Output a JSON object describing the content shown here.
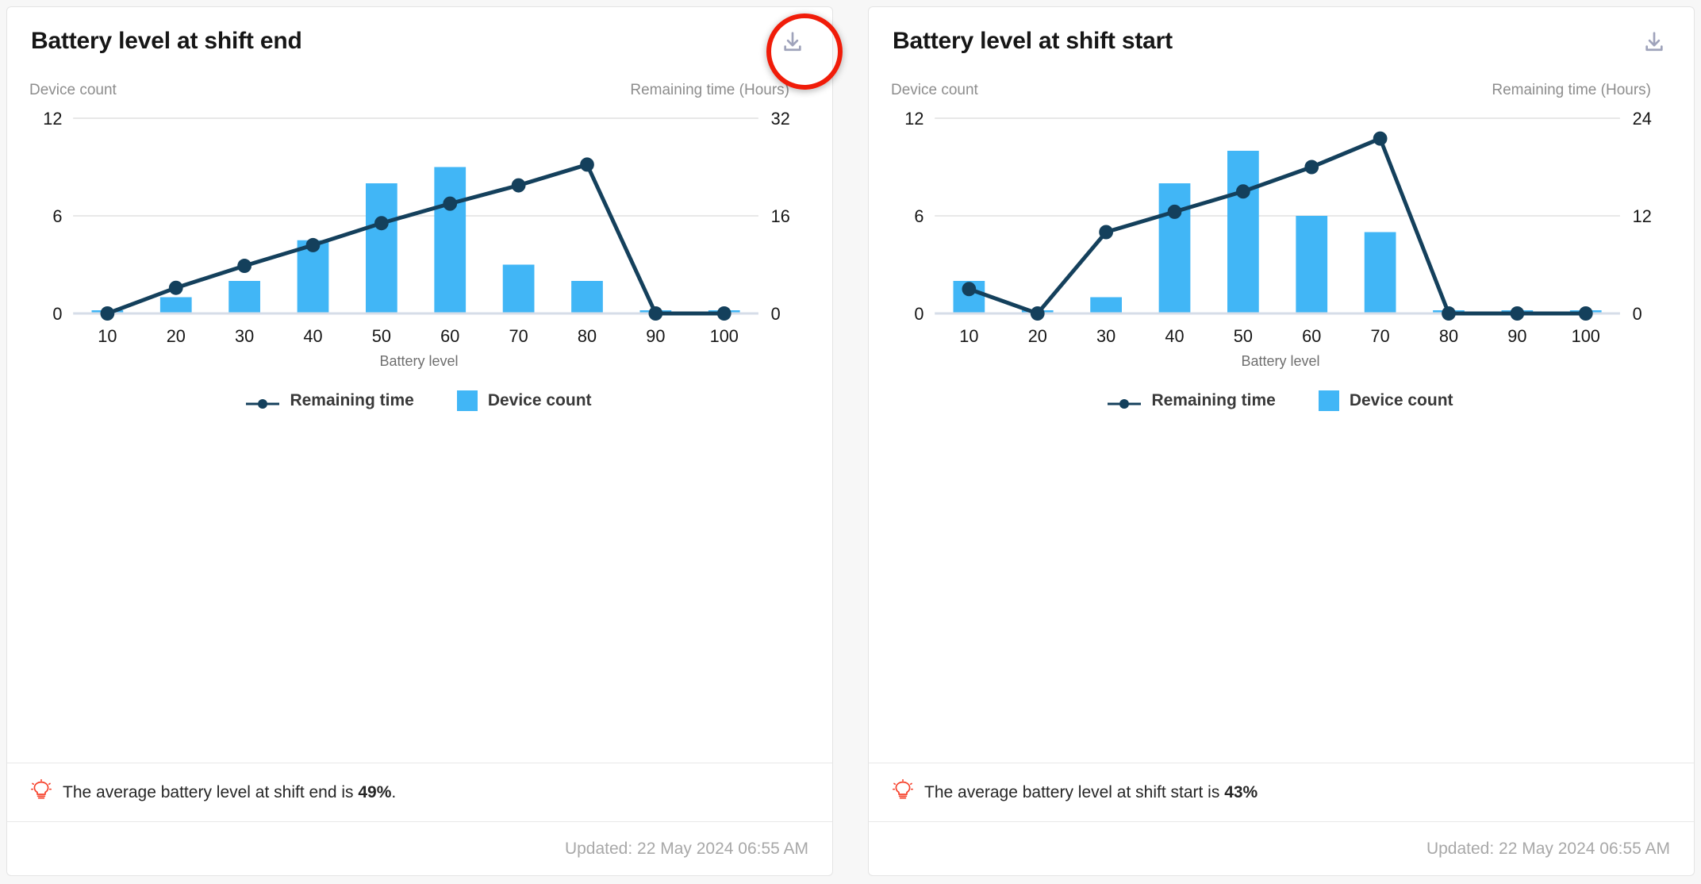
{
  "colors": {
    "bar": "#41b6f6",
    "line": "#14405c",
    "grid": "#e8e8e8",
    "baseline": "#d6dde8",
    "annotation": "#f01c09",
    "muted": "#8d8d8d",
    "title": "#161616"
  },
  "cards": [
    {
      "title": "Battery level at shift end",
      "download_icon": "download-icon",
      "left_axis_title": "Device count",
      "right_axis_title": "Remaining time (Hours)",
      "legend": [
        {
          "label": "Remaining time",
          "marker": "line-marker"
        },
        {
          "label": "Device count",
          "marker": "square-swatch"
        }
      ],
      "insight_icon": "lightbulb-icon",
      "insight_prefix": "The average battery level at shift end is ",
      "insight_value": "49%",
      "insight_suffix": ".",
      "updated": "Updated: 22 May 2024 06:55 AM",
      "chart_data": {
        "type": "bar",
        "title": "Battery level at shift end",
        "xlabel": "Battery level",
        "ylabel": "Device count",
        "y2label": "Remaining time (Hours)",
        "categories": [
          "10",
          "20",
          "30",
          "40",
          "50",
          "60",
          "70",
          "80",
          "90",
          "100"
        ],
        "ylim": [
          0,
          12
        ],
        "yticks": [
          0,
          6,
          12
        ],
        "y2lim": [
          0,
          32
        ],
        "y2ticks": [
          0,
          16,
          32
        ],
        "grid": true,
        "legend_position": "bottom-center",
        "series": [
          {
            "name": "Device count",
            "type": "bar",
            "axis": "left",
            "values": [
              0.12,
              1.0,
              2.0,
              4.5,
              8.0,
              9.0,
              3.0,
              2.0,
              0.12,
              0.12
            ]
          },
          {
            "name": "Remaining time",
            "type": "line",
            "axis": "right",
            "values": [
              0,
              4.2,
              7.8,
              11.2,
              14.8,
              18.0,
              21.0,
              24.4,
              0,
              0
            ]
          }
        ]
      }
    },
    {
      "title": "Battery level at shift start",
      "download_icon": "download-icon",
      "left_axis_title": "Device count",
      "right_axis_title": "Remaining time (Hours)",
      "legend": [
        {
          "label": "Remaining time",
          "marker": "line-marker"
        },
        {
          "label": "Device count",
          "marker": "square-swatch"
        }
      ],
      "insight_icon": "lightbulb-icon",
      "insight_prefix": "The average battery level at shift start is ",
      "insight_value": "43%",
      "insight_suffix": "",
      "updated": "Updated: 22 May 2024 06:55 AM",
      "chart_data": {
        "type": "bar",
        "title": "Battery level at shift start",
        "xlabel": "Battery level",
        "ylabel": "Device count",
        "y2label": "Remaining time (Hours)",
        "categories": [
          "10",
          "20",
          "30",
          "40",
          "50",
          "60",
          "70",
          "80",
          "90",
          "100"
        ],
        "ylim": [
          0,
          12
        ],
        "yticks": [
          0,
          6,
          12
        ],
        "y2lim": [
          0,
          24
        ],
        "y2ticks": [
          0,
          12,
          24
        ],
        "grid": true,
        "legend_position": "bottom-center",
        "series": [
          {
            "name": "Device count",
            "type": "bar",
            "axis": "left",
            "values": [
              2.0,
              0.12,
              1.0,
              8.0,
              10.0,
              6.0,
              5.0,
              0.12,
              0.12,
              0.12
            ]
          },
          {
            "name": "Remaining time",
            "type": "line",
            "axis": "right",
            "values": [
              3.0,
              0,
              10.0,
              12.5,
              15.0,
              18.0,
              21.5,
              0,
              0,
              0
            ]
          }
        ]
      }
    }
  ],
  "annotation": {
    "shape": "circle-highlight",
    "target": "download-icon-card-0"
  }
}
